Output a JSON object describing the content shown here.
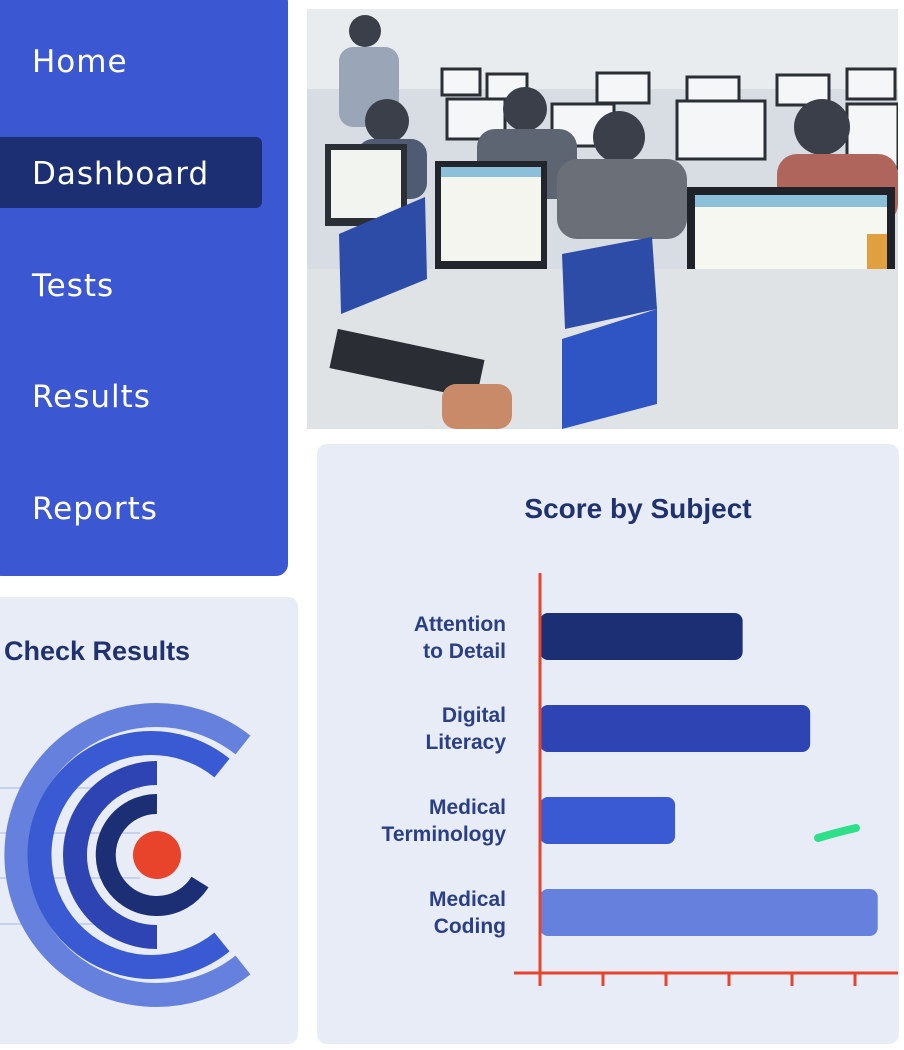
{
  "nav": {
    "items": [
      {
        "label": "Home"
      },
      {
        "label": "Dashboard",
        "active": true
      },
      {
        "label": "Tests"
      },
      {
        "label": "Results"
      },
      {
        "label": "Reports"
      }
    ],
    "colors": {
      "panel": "#3c57d2",
      "active": "#1b2f72",
      "text": "#ffffff"
    }
  },
  "photo": {
    "icon": "computer-lab-photo"
  },
  "check_results": {
    "title": "Check Results",
    "icon": "target-rings-icon"
  },
  "chart_data": {
    "type": "bar",
    "orientation": "horizontal",
    "title": "Score by Subject",
    "categories": [
      "Attention to Detail",
      "Digital Literacy",
      "Medical Terminology",
      "Medical Coding"
    ],
    "category_lines": [
      [
        "Attention",
        "to Detail"
      ],
      [
        "Digital",
        "Literacy"
      ],
      [
        "Medical",
        "Terminology"
      ],
      [
        "Medical",
        "Coding"
      ]
    ],
    "values": [
      3.3,
      4.4,
      2.2,
      5.5
    ],
    "xlim": [
      0,
      5.7
    ],
    "xticks": [
      0,
      1,
      2,
      3,
      4,
      5
    ],
    "grid": false,
    "bar_colors": [
      "#1c2f74",
      "#2e44b2",
      "#3a5ad4",
      "#6680de"
    ],
    "axis_color": "#e8442c"
  }
}
